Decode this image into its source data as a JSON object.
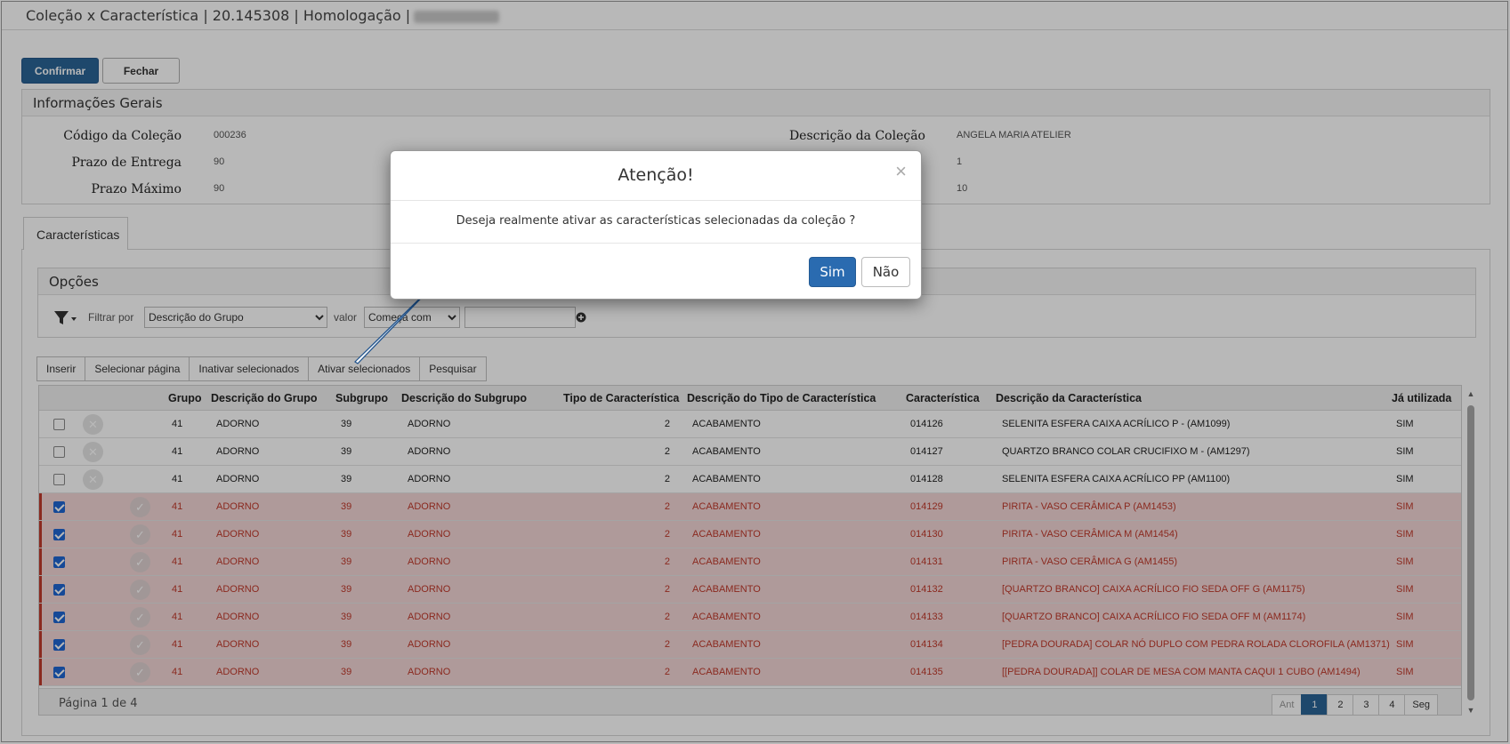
{
  "window": {
    "title": "Coleção x Característica | 20.145308 | Homologação |"
  },
  "actions": {
    "confirm_label": "Confirmar",
    "close_label": "Fechar"
  },
  "general_info": {
    "title": "Informações Gerais",
    "fields": [
      {
        "label": "Código da Coleção",
        "value": "000236"
      },
      {
        "label": "Prazo de Entrega",
        "value": "90"
      },
      {
        "label": "Prazo Máximo",
        "value": "90"
      }
    ],
    "right_fields": [
      {
        "label": "Descrição da Coleção",
        "value": "ANGELA MARIA ATELIER"
      },
      {
        "label": "",
        "value": "1"
      },
      {
        "label": "",
        "value": "10"
      }
    ]
  },
  "tabs": [
    {
      "label": "Características"
    }
  ],
  "options": {
    "title": "Opções",
    "filter_by_label": "Filtrar por",
    "filter_by_value": "Descrição do Grupo",
    "value_label": "valor",
    "operator_value": "Começa com",
    "text_value": ""
  },
  "toolbar": [
    {
      "label": "Inserir"
    },
    {
      "label": "Selecionar página"
    },
    {
      "label": "Inativar selecionados"
    },
    {
      "label": "Ativar selecionados"
    },
    {
      "label": "Pesquisar"
    }
  ],
  "grid": {
    "columns": [
      "Grupo",
      "Descrição do Grupo",
      "Subgrupo",
      "Descrição do Subgrupo",
      "Tipo de Característica",
      "Descrição do Tipo de Característica",
      "Característica",
      "Descrição da Característica",
      "Já utilizada"
    ],
    "rows": [
      {
        "checked": false,
        "grupo": "41",
        "desc_grupo": "ADORNO",
        "subgrupo": "39",
        "desc_subgrupo": "ADORNO",
        "tipo": "2",
        "desc_tipo": "ACABAMENTO",
        "caracteristica": "014126",
        "desc_caracteristica": "SELENITA ESFERA CAIXA ACRÍLICO P - (AM1099)",
        "utilizada": "SIM"
      },
      {
        "checked": false,
        "grupo": "41",
        "desc_grupo": "ADORNO",
        "subgrupo": "39",
        "desc_subgrupo": "ADORNO",
        "tipo": "2",
        "desc_tipo": "ACABAMENTO",
        "caracteristica": "014127",
        "desc_caracteristica": "QUARTZO BRANCO COLAR CRUCIFIXO M - (AM1297)",
        "utilizada": "SIM"
      },
      {
        "checked": false,
        "grupo": "41",
        "desc_grupo": "ADORNO",
        "subgrupo": "39",
        "desc_subgrupo": "ADORNO",
        "tipo": "2",
        "desc_tipo": "ACABAMENTO",
        "caracteristica": "014128",
        "desc_caracteristica": "SELENITA ESFERA CAIXA ACRÍLICO PP (AM1100)",
        "utilizada": "SIM"
      },
      {
        "checked": true,
        "grupo": "41",
        "desc_grupo": "ADORNO",
        "subgrupo": "39",
        "desc_subgrupo": "ADORNO",
        "tipo": "2",
        "desc_tipo": "ACABAMENTO",
        "caracteristica": "014129",
        "desc_caracteristica": "PIRITA - VASO CERÂMICA P (AM1453)",
        "utilizada": "SIM"
      },
      {
        "checked": true,
        "grupo": "41",
        "desc_grupo": "ADORNO",
        "subgrupo": "39",
        "desc_subgrupo": "ADORNO",
        "tipo": "2",
        "desc_tipo": "ACABAMENTO",
        "caracteristica": "014130",
        "desc_caracteristica": "PIRITA - VASO CERÂMICA M (AM1454)",
        "utilizada": "SIM"
      },
      {
        "checked": true,
        "grupo": "41",
        "desc_grupo": "ADORNO",
        "subgrupo": "39",
        "desc_subgrupo": "ADORNO",
        "tipo": "2",
        "desc_tipo": "ACABAMENTO",
        "caracteristica": "014131",
        "desc_caracteristica": "PIRITA - VASO CERÂMICA G (AM1455)",
        "utilizada": "SIM"
      },
      {
        "checked": true,
        "grupo": "41",
        "desc_grupo": "ADORNO",
        "subgrupo": "39",
        "desc_subgrupo": "ADORNO",
        "tipo": "2",
        "desc_tipo": "ACABAMENTO",
        "caracteristica": "014132",
        "desc_caracteristica": "[QUARTZO BRANCO] CAIXA ACRÍLICO FIO SEDA OFF G (AM1175)",
        "utilizada": "SIM"
      },
      {
        "checked": true,
        "grupo": "41",
        "desc_grupo": "ADORNO",
        "subgrupo": "39",
        "desc_subgrupo": "ADORNO",
        "tipo": "2",
        "desc_tipo": "ACABAMENTO",
        "caracteristica": "014133",
        "desc_caracteristica": "[QUARTZO BRANCO] CAIXA ACRÍLICO FIO SEDA OFF M (AM1174)",
        "utilizada": "SIM"
      },
      {
        "checked": true,
        "grupo": "41",
        "desc_grupo": "ADORNO",
        "subgrupo": "39",
        "desc_subgrupo": "ADORNO",
        "tipo": "2",
        "desc_tipo": "ACABAMENTO",
        "caracteristica": "014134",
        "desc_caracteristica": "[PEDRA DOURADA] COLAR NÓ DUPLO COM PEDRA ROLADA CLOROFILA (AM1371)",
        "utilizada": "SIM"
      },
      {
        "checked": true,
        "grupo": "41",
        "desc_grupo": "ADORNO",
        "subgrupo": "39",
        "desc_subgrupo": "ADORNO",
        "tipo": "2",
        "desc_tipo": "ACABAMENTO",
        "caracteristica": "014135",
        "desc_caracteristica": "[[PEDRA DOURADA]] COLAR DE MESA COM MANTA CAQUI 1 CUBO (AM1494)",
        "utilizada": "SIM"
      }
    ],
    "page_info": "Página 1 de 4",
    "pager": [
      {
        "label": "Ant"
      },
      {
        "label": "1"
      },
      {
        "label": "2"
      },
      {
        "label": "3"
      },
      {
        "label": "4"
      },
      {
        "label": "Seg"
      }
    ]
  },
  "modal": {
    "title": "Atenção!",
    "message": "Deseja realmente ativar as características selecionadas da coleção ?",
    "yes_label": "Sim",
    "no_label": "Não"
  },
  "colors": {
    "primary": "#2a6496",
    "selected_row": "#f3d6d6",
    "selected_text": "#c0392b",
    "arrow": "#1b4f8a"
  }
}
